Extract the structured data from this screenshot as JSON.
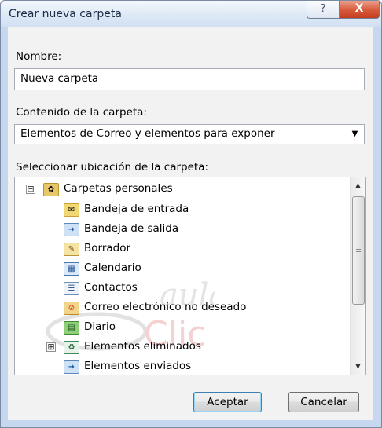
{
  "window": {
    "title": "Crear nueva carpeta",
    "help_glyph": "?",
    "close_glyph": "X"
  },
  "name_field": {
    "label": "Nombre:",
    "value": "Nueva carpeta"
  },
  "content_field": {
    "label": "Contenido de la carpeta:",
    "selected": "Elementos de Correo y elementos para exponer",
    "arrow_glyph": "▼"
  },
  "location": {
    "label": "Seleccionar ubicación de la carpeta:",
    "tree": [
      {
        "label": "Carpetas personales",
        "icon": "personal-folders-icon",
        "expander": "⊟"
      },
      {
        "label": "Bandeja de entrada",
        "icon": "inbox-icon"
      },
      {
        "label": "Bandeja de salida",
        "icon": "outbox-icon"
      },
      {
        "label": "Borrador",
        "icon": "drafts-icon"
      },
      {
        "label": "Calendario",
        "icon": "calendar-icon"
      },
      {
        "label": "Contactos",
        "icon": "contacts-icon"
      },
      {
        "label": "Correo electrónico no deseado",
        "icon": "junk-mail-icon"
      },
      {
        "label": "Diario",
        "icon": "journal-icon"
      },
      {
        "label": "Elementos eliminados",
        "icon": "deleted-items-icon",
        "expander": "⊞"
      },
      {
        "label": "Elementos enviados",
        "icon": "sent-items-icon"
      }
    ]
  },
  "scrollbar": {
    "up_glyph": "▲",
    "down_glyph": "▼"
  },
  "watermark": {
    "line1": "aula",
    "line2": "Clic"
  },
  "buttons": {
    "ok": "Aceptar",
    "cancel": "Cancelar"
  },
  "colors": {
    "accent": "#3c7fb1",
    "close": "#c33e1f",
    "frame": "#c6d8ef"
  }
}
